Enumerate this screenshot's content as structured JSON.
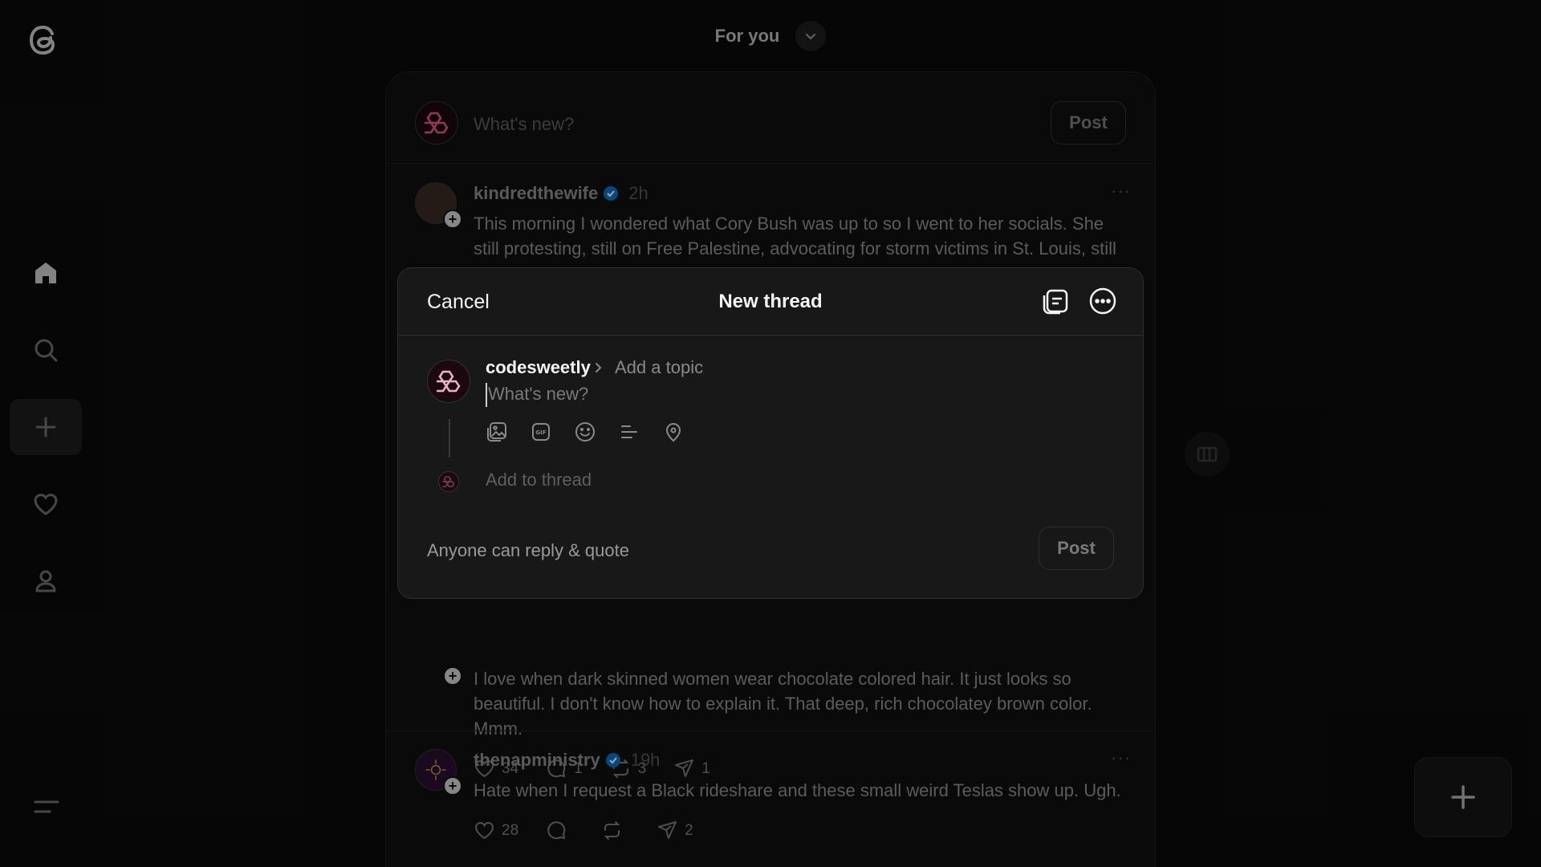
{
  "app": {
    "name": "Threads"
  },
  "sidebar": {
    "items": [
      {
        "name": "home",
        "icon": "home-icon",
        "active": true
      },
      {
        "name": "search",
        "icon": "search-icon"
      },
      {
        "name": "create",
        "icon": "plus-icon"
      },
      {
        "name": "activity",
        "icon": "heart-icon"
      },
      {
        "name": "profile",
        "icon": "person-icon"
      }
    ],
    "menu_icon": "menu-icon"
  },
  "header": {
    "feed_title": "For you",
    "dropdown_icon": "chevron-down-icon"
  },
  "composer": {
    "placeholder": "What's new?",
    "post_label": "Post"
  },
  "posts": [
    {
      "username": "kindredthewife",
      "verified": true,
      "time": "2h",
      "text": "This morning I wondered what Cory Bush was up to so I went to her socials. She still protesting, still on Free Palestine, advocating for storm victims in St. Louis, still"
    },
    {
      "username": "",
      "verified": false,
      "time": "",
      "text": "I love when dark skinned women wear chocolate colored hair. It just looks so beautiful. I don't know how to explain it. That deep, rich chocolatey brown color. Mmm.",
      "likes": "34",
      "replies": "1",
      "reposts": "3",
      "shares": "1"
    },
    {
      "username": "thenapministry",
      "verified": true,
      "time": "19h",
      "text": "Hate when I request a Black rideshare and these small weird Teslas show up. Ugh.",
      "likes": "28",
      "replies": "",
      "reposts": "",
      "shares": "2"
    }
  ],
  "modal": {
    "cancel_label": "Cancel",
    "title": "New thread",
    "drafts_icon": "drafts-icon",
    "more_icon": "more-circle-icon",
    "username": "codesweetly",
    "add_topic": "Add a topic",
    "placeholder": "What's new?",
    "toolbar_icons": [
      "image-icon",
      "gif-icon",
      "emoji-icon",
      "poll-icon",
      "location-icon"
    ],
    "add_to_thread": "Add to thread",
    "reply_setting": "Anyone can reply & quote",
    "post_label": "Post"
  },
  "colors": {
    "background": "#0a0a0a",
    "feed_bg": "#101010",
    "modal_bg": "#181818",
    "text_primary": "#f3f5f7",
    "verified_blue": "#0095f6",
    "avatar_accent": "#e0245e"
  }
}
